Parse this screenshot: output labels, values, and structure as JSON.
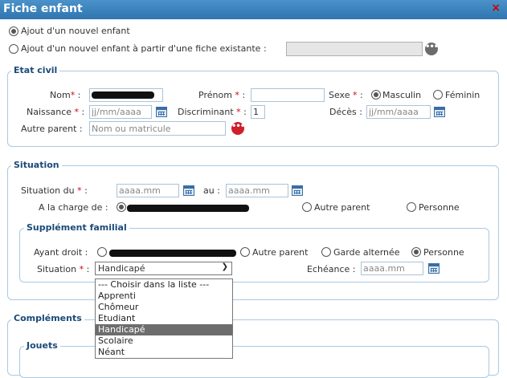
{
  "window": {
    "title": "Fiche enfant",
    "close_glyph": "×"
  },
  "mode": {
    "option_new": "Ajout d'un nouvel enfant",
    "option_from_existing": "Ajout d'un nouvel enfant à partir d'une fiche existante :",
    "existing_value": ""
  },
  "etat_civil": {
    "legend": "Etat civil",
    "nom_label": "Nom",
    "prenom_label": "Prénom",
    "prenom_value": "",
    "sexe_label": "Sexe",
    "sexe_options": [
      "Masculin",
      "Féminin"
    ],
    "sexe_selected": "Masculin",
    "naissance_label": "Naissance",
    "naissance_placeholder": "jj/mm/aaaa",
    "discriminant_label": "Discriminant",
    "discriminant_value": "1",
    "deces_label": "Décès :",
    "deces_placeholder": "jj/mm/aaaa",
    "autre_parent_label": "Autre parent :",
    "autre_parent_placeholder": "Nom ou matricule"
  },
  "situation": {
    "legend": "Situation",
    "situation_du_label": "Situation du",
    "situation_du_placeholder": "aaaa.mm",
    "au_label": "au :",
    "au_placeholder": "aaaa.mm",
    "a_charge_label": "A la charge de :",
    "a_charge_options": [
      "Autre parent",
      "Personne"
    ]
  },
  "supplement": {
    "legend": "Supplément familial",
    "ayant_droit_label": "Ayant droit :",
    "ayant_droit_options": [
      "Autre parent",
      "Garde alternée",
      "Personne"
    ],
    "ayant_droit_selected": "Personne",
    "situation_label": "Situation",
    "situation_selected": "Handicapé",
    "situation_options": [
      "--- Choisir dans la liste ---",
      "Apprenti",
      "Chômeur",
      "Etudiant",
      "Handicapé",
      "Scolaire",
      "Néant"
    ],
    "echeance_label": "Echéance :",
    "echeance_placeholder": "aaaa.mm"
  },
  "complements": {
    "legend": "Compléments",
    "jouets_legend": "Jouets"
  },
  "icons": {
    "calendar": "calendar-icon",
    "more": "more-options-icon",
    "dots_glyph": "•••"
  },
  "colors": {
    "title_bar": "#2f76b0",
    "legend": "#1b4a78",
    "required": "#d0021b",
    "fieldset_border": "#a9c9e4"
  }
}
